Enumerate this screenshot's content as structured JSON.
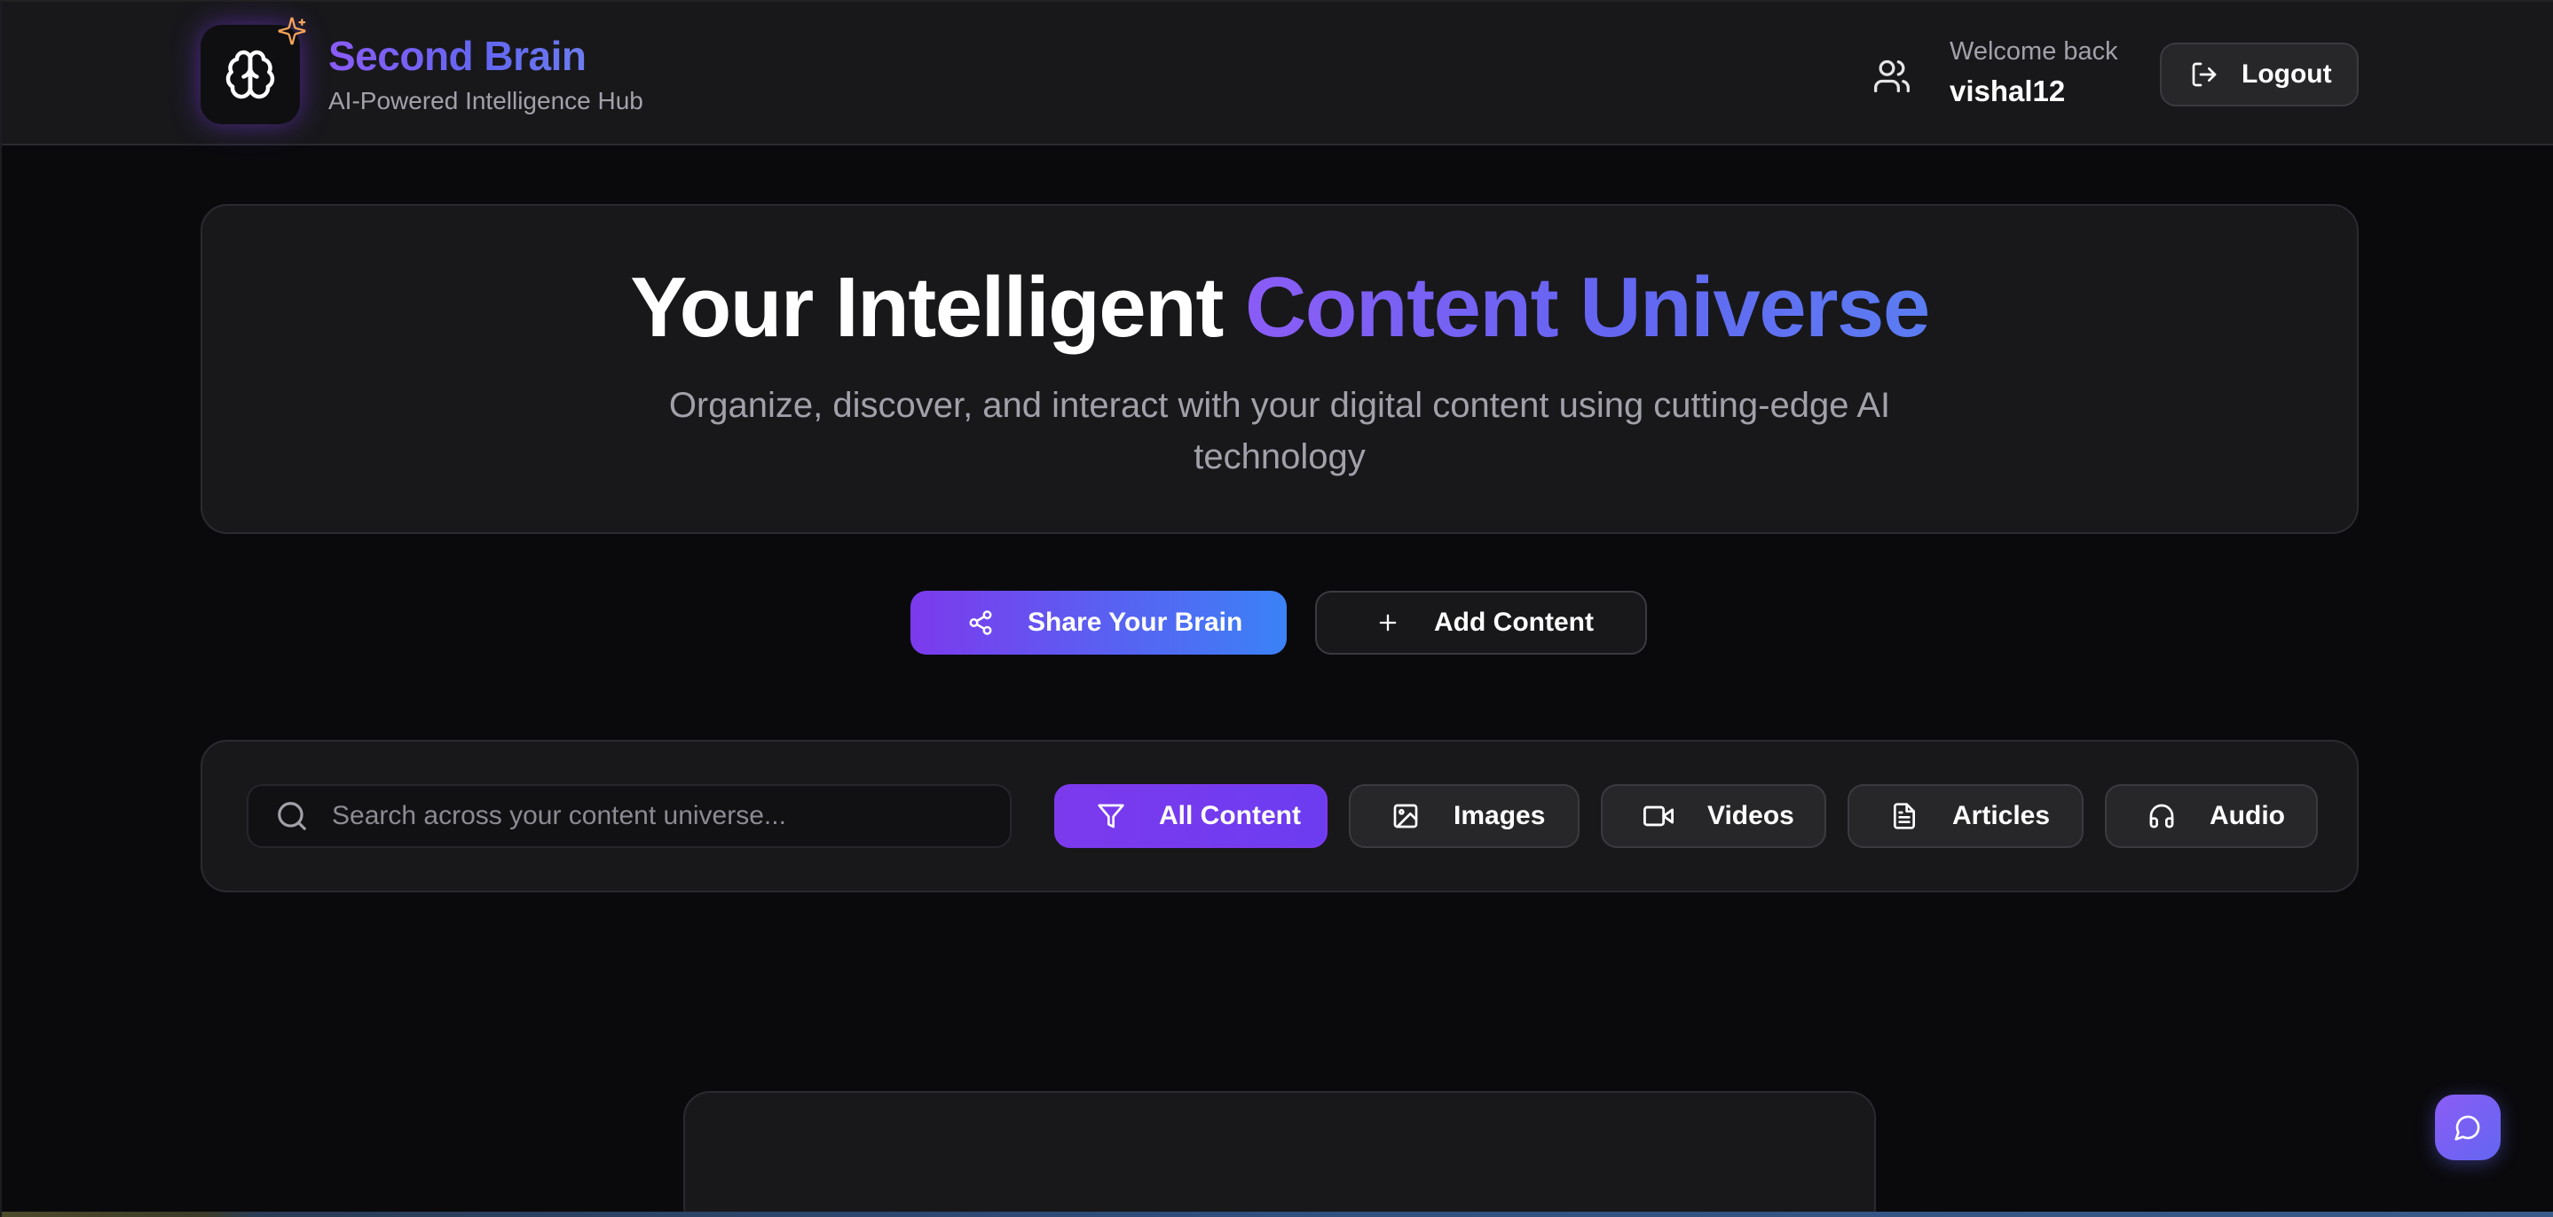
{
  "header": {
    "brand_title": "Second Brain",
    "brand_subtitle": "AI-Powered Intelligence Hub",
    "logo_icon": "brain-icon",
    "sparkle_icon": "sparkles-icon",
    "welcome_text": "Welcome back",
    "username": "vishal12",
    "user_icon": "users-icon",
    "logout_label": "Logout",
    "logout_icon": "log-out-icon"
  },
  "hero": {
    "title_plain": "Your Intelligent ",
    "title_highlight": "Content Universe",
    "subtitle_line1": "Organize, discover, and interact with your digital content using cutting-edge AI",
    "subtitle_line2": "technology"
  },
  "actions": {
    "share_label": "Share Your Brain",
    "share_icon": "share-icon",
    "add_label": "Add Content",
    "add_icon": "plus-icon"
  },
  "filters": {
    "search_placeholder": "Search across your content universe...",
    "search_value": "",
    "chips": [
      {
        "label": "All Content",
        "icon": "filter-icon",
        "active": true
      },
      {
        "label": "Images",
        "icon": "image-icon",
        "active": false
      },
      {
        "label": "Videos",
        "icon": "video-icon",
        "active": false
      },
      {
        "label": "Articles",
        "icon": "file-text-icon",
        "active": false
      },
      {
        "label": "Audio",
        "icon": "headphones-icon",
        "active": false
      }
    ]
  },
  "chat": {
    "icon": "message-circle-icon"
  },
  "colors": {
    "accent_purple": "#7c3aed",
    "accent_blue": "#3b82f6",
    "background": "#0a0a0d",
    "card": "#18181b"
  }
}
